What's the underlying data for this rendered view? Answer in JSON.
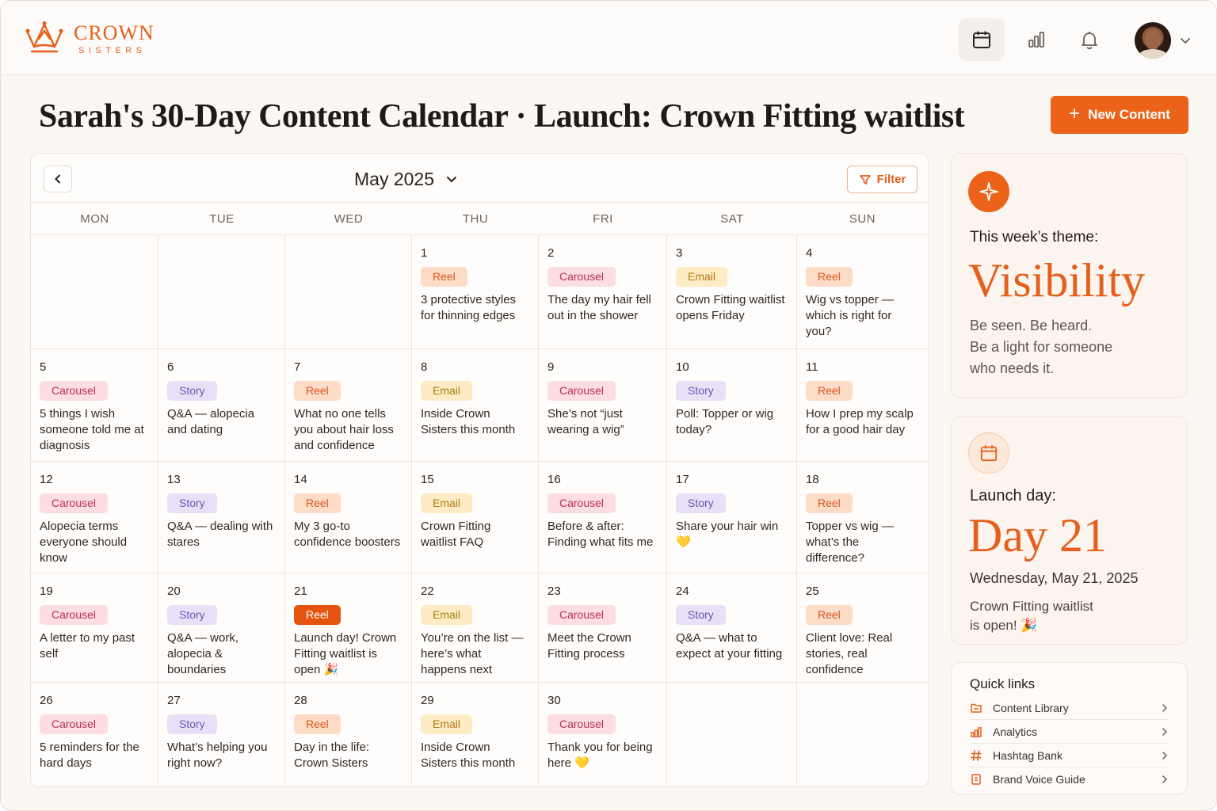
{
  "brand": {
    "name": "CROWN",
    "sub": "SISTERS",
    "accent": "#ec6219"
  },
  "nav": {
    "icons": [
      "calendar-icon",
      "analytics-icon",
      "bell-icon"
    ]
  },
  "page": {
    "title": "Sarah's 30-Day Content Calendar · Launch: Crown Fitting waitlist"
  },
  "actions": {
    "new_content": "New Content"
  },
  "calendar": {
    "month_label": "May 2025",
    "filter_label": "Filter",
    "weekdays": [
      "MON",
      "TUE",
      "WED",
      "THU",
      "FRI",
      "SAT",
      "SUN"
    ],
    "weeks": [
      [
        null,
        null,
        null,
        {
          "day": "1",
          "type": "Reel",
          "title": "3 protective styles for thinning edges"
        },
        {
          "day": "2",
          "type": "Carousel",
          "title": "The day my hair fell out in the shower"
        },
        {
          "day": "3",
          "type": "Email",
          "title": "Crown Fitting waitlist opens Friday"
        },
        {
          "day": "4",
          "type": "Reel",
          "title": "Wig vs topper — which is right for you?"
        }
      ],
      [
        {
          "day": "5",
          "type": "Carousel",
          "title": "5 things I wish someone told me at diagnosis"
        },
        {
          "day": "6",
          "type": "Story",
          "title": "Q&A — alopecia and dating"
        },
        {
          "day": "7",
          "type": "Reel",
          "title": "What no one tells you about hair loss and confidence"
        },
        {
          "day": "8",
          "type": "Email",
          "title": "Inside Crown Sisters this month"
        },
        {
          "day": "9",
          "type": "Carousel",
          "title": "She’s not “just wearing a wig”"
        },
        {
          "day": "10",
          "type": "Story",
          "title": "Poll: Topper or wig today?"
        },
        {
          "day": "11",
          "type": "Reel",
          "title": "How I prep my scalp for a good hair day"
        }
      ],
      [
        {
          "day": "12",
          "type": "Carousel",
          "title": "Alopecia terms everyone should know"
        },
        {
          "day": "13",
          "type": "Story",
          "title": "Q&A — dealing with stares"
        },
        {
          "day": "14",
          "type": "Reel",
          "title": "My 3 go-to confidence boosters"
        },
        {
          "day": "15",
          "type": "Email",
          "title": "Crown Fitting waitlist FAQ"
        },
        {
          "day": "16",
          "type": "Carousel",
          "title": "Before & after: Finding what fits me"
        },
        {
          "day": "17",
          "type": "Story",
          "title": "Share your hair win 💛"
        },
        {
          "day": "18",
          "type": "Reel",
          "title": "Topper vs wig — what’s the difference?"
        }
      ],
      [
        {
          "day": "19",
          "type": "Carousel",
          "title": "A letter to my past self"
        },
        {
          "day": "20",
          "type": "Story",
          "title": "Q&A — work, alopecia & boundaries"
        },
        {
          "day": "21",
          "type": "Reel",
          "title": "Launch day! Crown Fitting waitlist is open 🎉",
          "launch": true
        },
        {
          "day": "22",
          "type": "Email",
          "title": "You’re on the list — here’s what happens next"
        },
        {
          "day": "23",
          "type": "Carousel",
          "title": "Meet the Crown Fitting process"
        },
        {
          "day": "24",
          "type": "Story",
          "title": "Q&A — what to expect at your fitting"
        },
        {
          "day": "25",
          "type": "Reel",
          "title": "Client love: Real stories, real confidence"
        }
      ],
      [
        {
          "day": "26",
          "type": "Carousel",
          "title": "5 reminders for the hard days"
        },
        {
          "day": "27",
          "type": "Story",
          "title": "What’s helping you right now?"
        },
        {
          "day": "28",
          "type": "Reel",
          "title": "Day in the life: Crown Sisters"
        },
        {
          "day": "29",
          "type": "Email",
          "title": "Inside Crown Sisters this month"
        },
        {
          "day": "30",
          "type": "Carousel",
          "title": "Thank you for being here 💛"
        },
        null,
        null
      ]
    ],
    "tag_colors": {
      "Reel": "#d8561a",
      "Carousel": "#b8314f",
      "Email": "#b07a14",
      "Story": "#6f54b4"
    }
  },
  "theme": {
    "label": "This week’s theme:",
    "word": "Visibility",
    "lines": [
      "Be seen. Be heard.",
      "Be a light for someone",
      "who needs it."
    ]
  },
  "launch": {
    "label": "Launch day:",
    "day": "Day 21",
    "date": "Wednesday, May 21, 2025",
    "lines": [
      "Crown Fitting waitlist",
      "is open! 🎉"
    ]
  },
  "quick_links": {
    "title": "Quick links",
    "items": [
      {
        "label": "Content Library",
        "icon": "folder-icon"
      },
      {
        "label": "Analytics",
        "icon": "analytics-icon"
      },
      {
        "label": "Hashtag Bank",
        "icon": "hashtag-icon"
      },
      {
        "label": "Brand Voice Guide",
        "icon": "document-icon"
      }
    ]
  }
}
